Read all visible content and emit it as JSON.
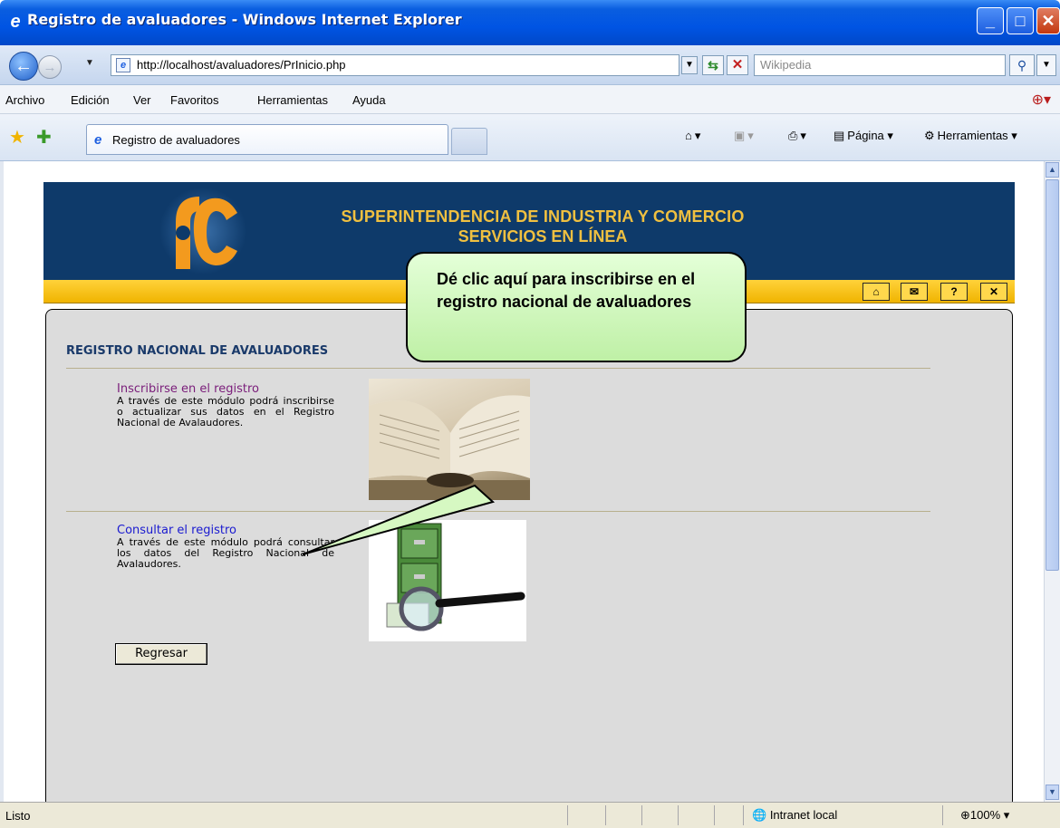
{
  "window": {
    "title": "Registro de avaluadores - Windows Internet Explorer"
  },
  "address_bar": {
    "url": "http://localhost/avaluadores/PrInicio.php",
    "search_placeholder": "Wikipedia"
  },
  "menu": {
    "items": [
      "Archivo",
      "Edición",
      "Ver",
      "Favoritos",
      "Herramientas",
      "Ayuda"
    ]
  },
  "tab": {
    "title": "Registro de avaluadores"
  },
  "command_bar": {
    "page_label": "Página",
    "tools_label": "Herramientas"
  },
  "banner": {
    "line1": "SUPERINTENDENCIA DE INDUSTRIA Y COMERCIO",
    "line2": "SERVICIOS EN LÍNEA"
  },
  "toolbar_icons": [
    "home-icon",
    "mail-icon",
    "help-icon",
    "close-icon"
  ],
  "content": {
    "heading": "REGISTRO NACIONAL DE AVALUADORES",
    "items": [
      {
        "link": "Inscribirse en el registro",
        "description": "A través de este módulo podrá inscribirse o actualizar sus datos en el Registro Nacional de Avalaudores."
      },
      {
        "link": "Consultar el registro",
        "description": "A través de este módulo podrá consultar los datos del Registro Nacional de Avalaudores."
      }
    ],
    "back_button": "Regresar"
  },
  "callout": {
    "text": "Dé clic aquí para inscribirse en el registro nacional de avaluadores"
  },
  "status_bar": {
    "status": "Listo",
    "zone": "Intranet local",
    "zoom": "100%"
  },
  "colors": {
    "titlebar": "#0054e3",
    "banner": "#0e3a6a",
    "banner_text": "#f0c040",
    "yellow_bar": "#f0b400",
    "panel": "#dcdcdc",
    "callout": "#c8f5b0"
  }
}
